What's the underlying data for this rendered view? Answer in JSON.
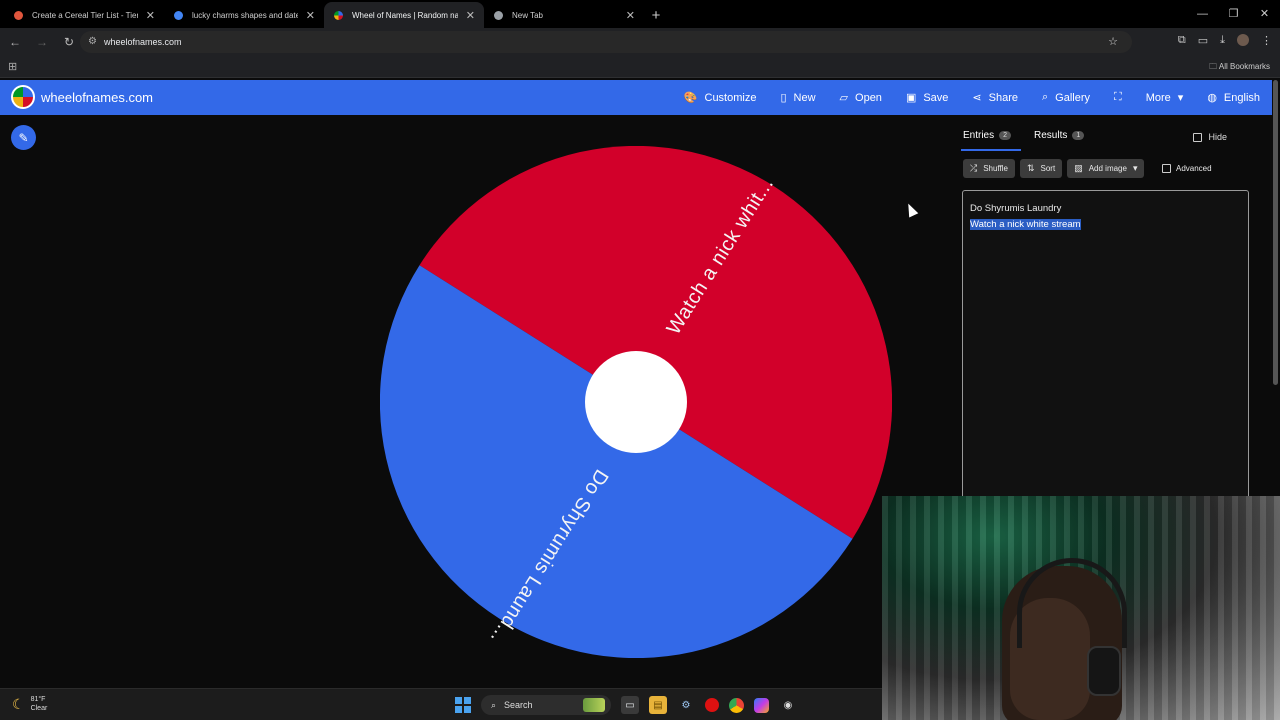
{
  "browser": {
    "tabs": [
      {
        "title": "Create a Cereal Tier List - TierM",
        "favicon_color": "#e0563d"
      },
      {
        "title": "lucky charms shapes and dates",
        "favicon_color": "#4285f4"
      },
      {
        "title": "Wheel of Names | Random nam",
        "favicon_color": "#34a853",
        "active": true
      },
      {
        "title": "New Tab",
        "favicon_color": "#9aa0a6"
      }
    ],
    "url": "wheelofnames.com",
    "bookmarks_label": "All Bookmarks"
  },
  "site": {
    "brand": "wheelofnames.com",
    "menu": [
      {
        "label": "Customize",
        "icon": "palette-icon"
      },
      {
        "label": "New",
        "icon": "file-icon"
      },
      {
        "label": "Open",
        "icon": "folder-icon"
      },
      {
        "label": "Save",
        "icon": "save-icon"
      },
      {
        "label": "Share",
        "icon": "share-icon"
      },
      {
        "label": "Gallery",
        "icon": "search-icon"
      },
      {
        "label": "",
        "icon": "fullscreen-icon"
      },
      {
        "label": "More",
        "icon": "chevron-down-icon"
      },
      {
        "label": "English",
        "icon": "globe-icon"
      }
    ],
    "accent_color": "#3369e8"
  },
  "wheel": {
    "segments": [
      {
        "label": "Watch a nick whit...",
        "color": "#d2002a"
      },
      {
        "label": "Do Shyrumis Laund...",
        "color": "#3369e8"
      }
    ],
    "pointer_color": "#d2002a"
  },
  "panel": {
    "tabs": [
      {
        "label": "Entries",
        "count": "2",
        "active": true
      },
      {
        "label": "Results",
        "count": "1"
      }
    ],
    "hide_label": "Hide",
    "buttons": [
      {
        "label": "Shuffle",
        "icon": "shuffle-icon"
      },
      {
        "label": "Sort",
        "icon": "sort-icon"
      },
      {
        "label": "Add image",
        "icon": "image-icon"
      }
    ],
    "advanced_label": "Advanced",
    "entries": [
      "Do Shyrumis Laundry",
      "Watch a nick white stream"
    ]
  },
  "taskbar": {
    "temperature": "81°F",
    "condition": "Clear",
    "search_label": "Search"
  }
}
